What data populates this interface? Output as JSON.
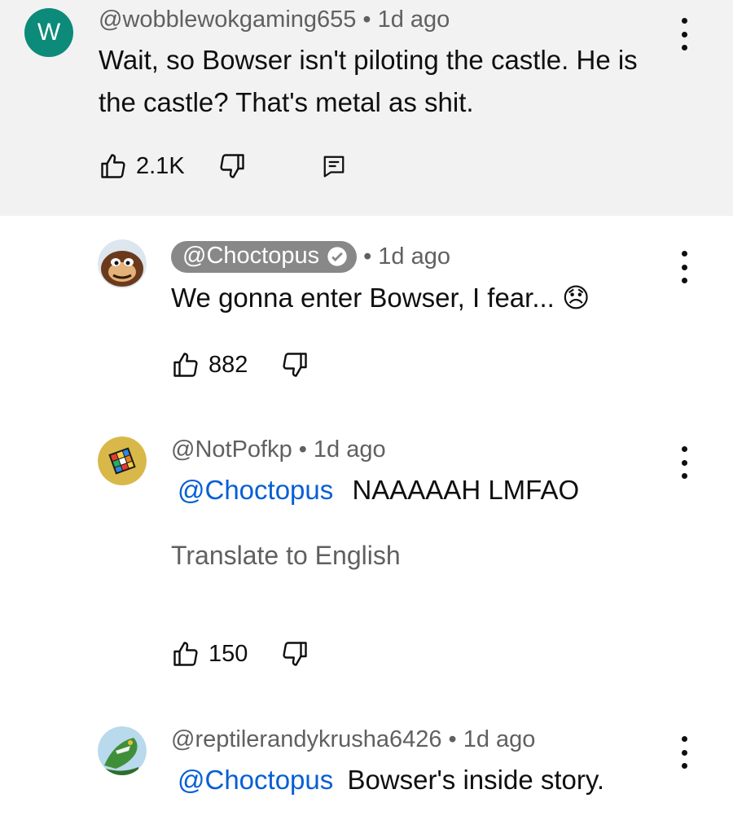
{
  "comments": [
    {
      "author": "@wobblewokgaming655",
      "avatar_letter": "W",
      "time": "1d ago",
      "text_line1": "Wait, so Bowser isn't piloting the castle.  He is",
      "text_line2": "the castle?  That's metal as shit.",
      "likes": "2.1K"
    },
    {
      "author": "@Choctopus",
      "time": "1d ago",
      "text": "We gonna enter Bowser, I fear...",
      "emoji": "😞",
      "likes": "882"
    },
    {
      "author": "@NotPofkp",
      "time": "1d ago",
      "mention": "@Choctopus",
      "text": "NAAAAAH LMFAO",
      "translate": "Translate to English",
      "likes": "150"
    },
    {
      "author": "@reptilerandykrusha6426",
      "time": "1d ago",
      "mention": "@Choctopus",
      "text": "Bowser's inside story."
    }
  ],
  "dot_separator": "•",
  "icons": [
    "like-icon",
    "dislike-icon",
    "reply-icon",
    "more-options-icon",
    "verified-icon"
  ]
}
